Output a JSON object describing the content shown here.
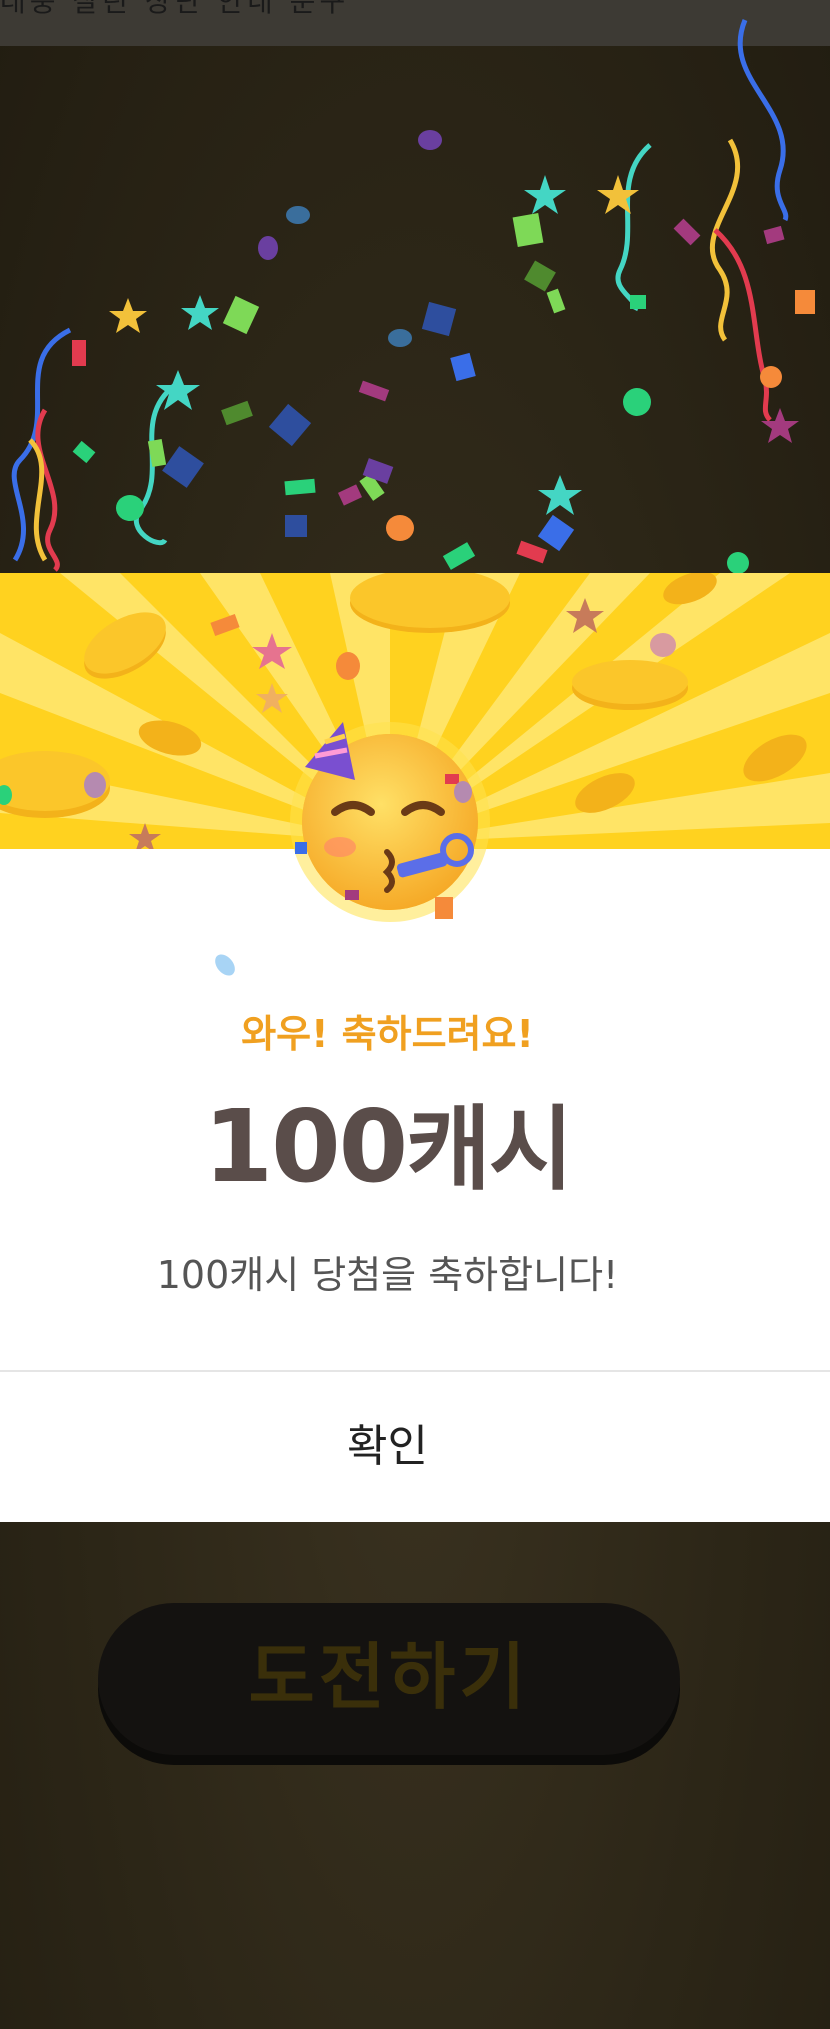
{
  "status_bar": {
    "text": "대충 잘린 상단 안내 문구"
  },
  "popup": {
    "emoji": "partying-face",
    "headline": "와우! 축하드려요!",
    "reward_amount": "100",
    "reward_unit": "캐시",
    "message": "100캐시 당첨을 축하합니다!",
    "confirm_label": "확인"
  },
  "background": {
    "challenge_label": "도전하기"
  },
  "colors": {
    "banner_yellow": "#ffd21f",
    "headline_orange": "#f0a020",
    "amount_text": "#5a4d4a",
    "overlay_dark": "#2c2617"
  }
}
